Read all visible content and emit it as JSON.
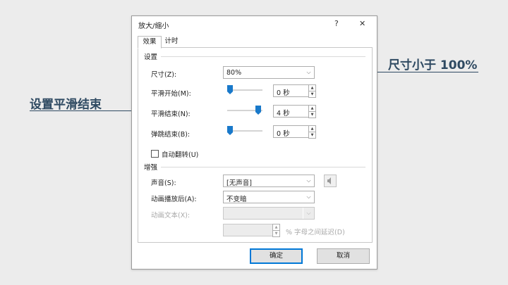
{
  "annotations": {
    "right": "尺寸小于 100%",
    "left": "设置平滑结束"
  },
  "dialog": {
    "title": "放大/缩小",
    "help_label": "?",
    "close_label": "✕",
    "tabs": [
      {
        "label": "效果",
        "active": true
      },
      {
        "label": "计时",
        "active": false
      }
    ],
    "settings": {
      "section_label": "设置",
      "size_label": "尺寸(Z):",
      "size_value": "80%",
      "smooth_start_label": "平滑开始(M):",
      "smooth_start_value": "0 秒",
      "smooth_start_level": 0.0,
      "smooth_end_label": "平滑结束(N):",
      "smooth_end_value": "4 秒",
      "smooth_end_level": 0.8,
      "bounce_end_label": "弹跳结束(B):",
      "bounce_end_value": "0 秒",
      "bounce_end_level": 0.0,
      "auto_reverse_label": "自动翻转(U)",
      "auto_reverse_checked": false
    },
    "enhance": {
      "section_label": "增强",
      "sound_label": "声音(S):",
      "sound_value": "[无声音]",
      "after_anim_label": "动画播放后(A):",
      "after_anim_value": "不变暗",
      "anim_text_label": "动画文本(X):",
      "anim_text_value": "",
      "letter_delay_value": "",
      "letter_delay_label": "% 字母之间延迟(D)"
    },
    "ok_label": "确定",
    "cancel_label": "取消"
  },
  "colors": {
    "accent": "#1979ca",
    "annotation": "#2f4a62"
  }
}
